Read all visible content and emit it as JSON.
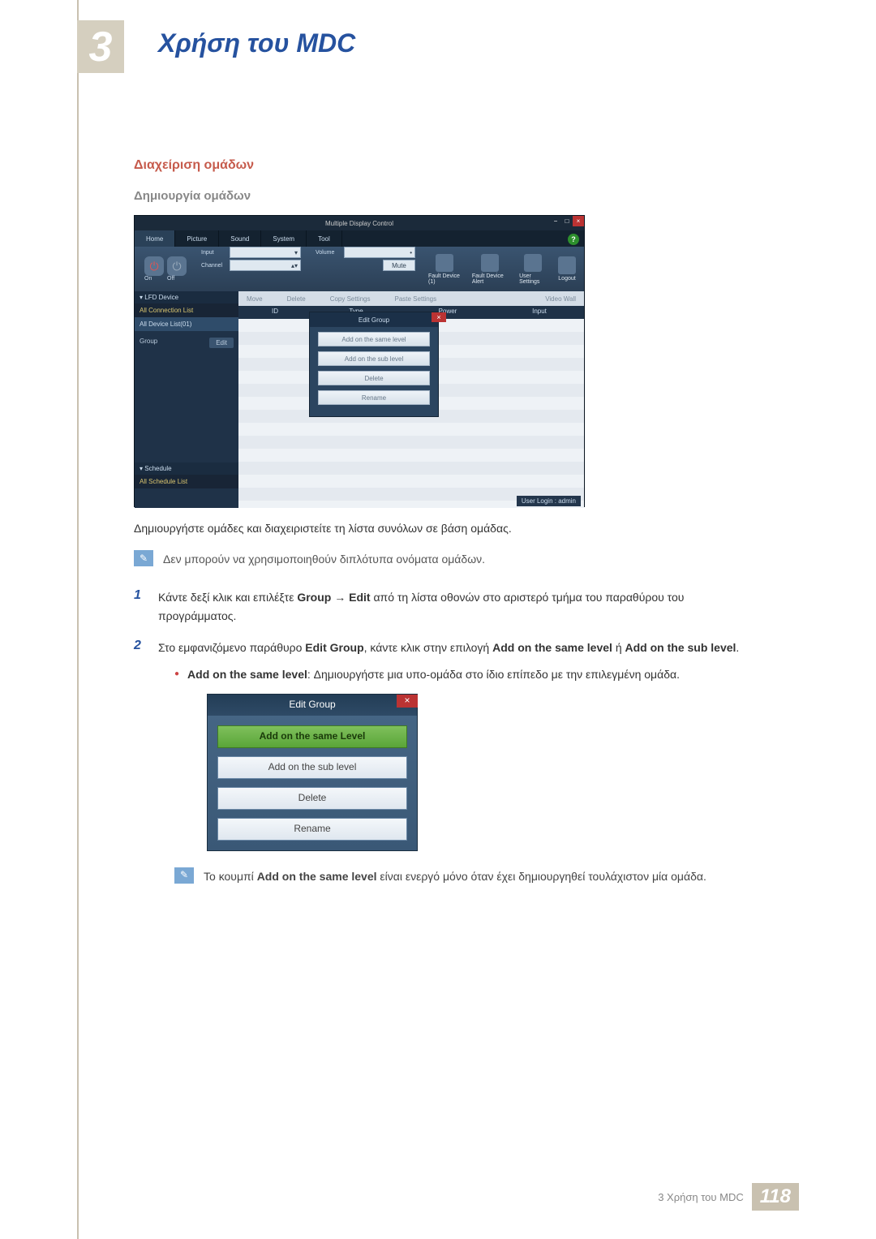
{
  "chapter": {
    "number": "3",
    "title": "Χρήση του MDC"
  },
  "section": {
    "title": "Διαχείριση ομάδων",
    "subtitle": "Δημιουργία ομάδων",
    "intro": "Δημιουργήστε ομάδες και διαχειριστείτε τη λίστα συνόλων σε βάση ομάδας.",
    "note1": "Δεν μπορούν να χρησιμοποιηθούν διπλότυπα ονόματα ομάδων."
  },
  "mdc": {
    "title": "Multiple Display Control",
    "tabs": [
      "Home",
      "Picture",
      "Sound",
      "System",
      "Tool"
    ],
    "ribbon": {
      "on": "On",
      "off": "Off",
      "input_lbl": "Input",
      "channel_lbl": "Channel",
      "volume_lbl": "Volume",
      "mute": "Mute",
      "fault1": "Fault Device (1)",
      "fault2": "Fault Device Alert",
      "user_settings": "User Settings",
      "logout": "Logout"
    },
    "side": {
      "lfd": "LFD Device",
      "all_conn": "All Connection List",
      "all_dev": "All Device List(01)",
      "group": "Group",
      "edit": "Edit",
      "schedule": "Schedule",
      "all_sched": "All Schedule List"
    },
    "toolbar": {
      "move": "Move",
      "delete": "Delete",
      "copy": "Copy Settings",
      "paste": "Paste Settings",
      "videowall": "Video Wall"
    },
    "cols": {
      "id": "ID",
      "type": "Type",
      "power": "Power",
      "input": "Input"
    },
    "userlogin": "User Login : admin"
  },
  "edit_popup": {
    "title": "Edit Group",
    "b1": "Add on the same level",
    "b2": "Add on the sub level",
    "b3": "Delete",
    "b4": "Rename"
  },
  "steps": {
    "s1a": "Κάντε δεξί κλικ και επιλέξτε ",
    "s1b": "Group",
    "s1c": " → ",
    "s1d": "Edit",
    "s1e": " από τη λίστα οθονών στο αριστερό τμήμα του παραθύρου του προγράμματος.",
    "s2a": "Στο εμφανιζόμενο παράθυρο ",
    "s2b": "Edit Group",
    "s2c": ", κάντε κλικ στην επιλογή ",
    "s2d": "Add on the same level",
    "s2e": " ή ",
    "s2f": "Add on the sub level",
    "s2g": ".",
    "bullet_a": "Add on the same level",
    "bullet_b": ": Δημιουργήστε μια υπο-ομάδα στο ίδιο επίπεδο με την επιλεγμένη ομάδα.",
    "note2a": "Το κουμπί ",
    "note2b": "Add on the same level",
    "note2c": " είναι ενεργό μόνο όταν έχει δημιουργηθεί τουλάχιστον μία ομάδα."
  },
  "edit_large": {
    "title": "Edit Group",
    "b1": "Add on the same Level",
    "b2": "Add on the sub level",
    "b3": "Delete",
    "b4": "Rename"
  },
  "footer": {
    "text": "3 Χρήση του MDC",
    "page": "118"
  }
}
